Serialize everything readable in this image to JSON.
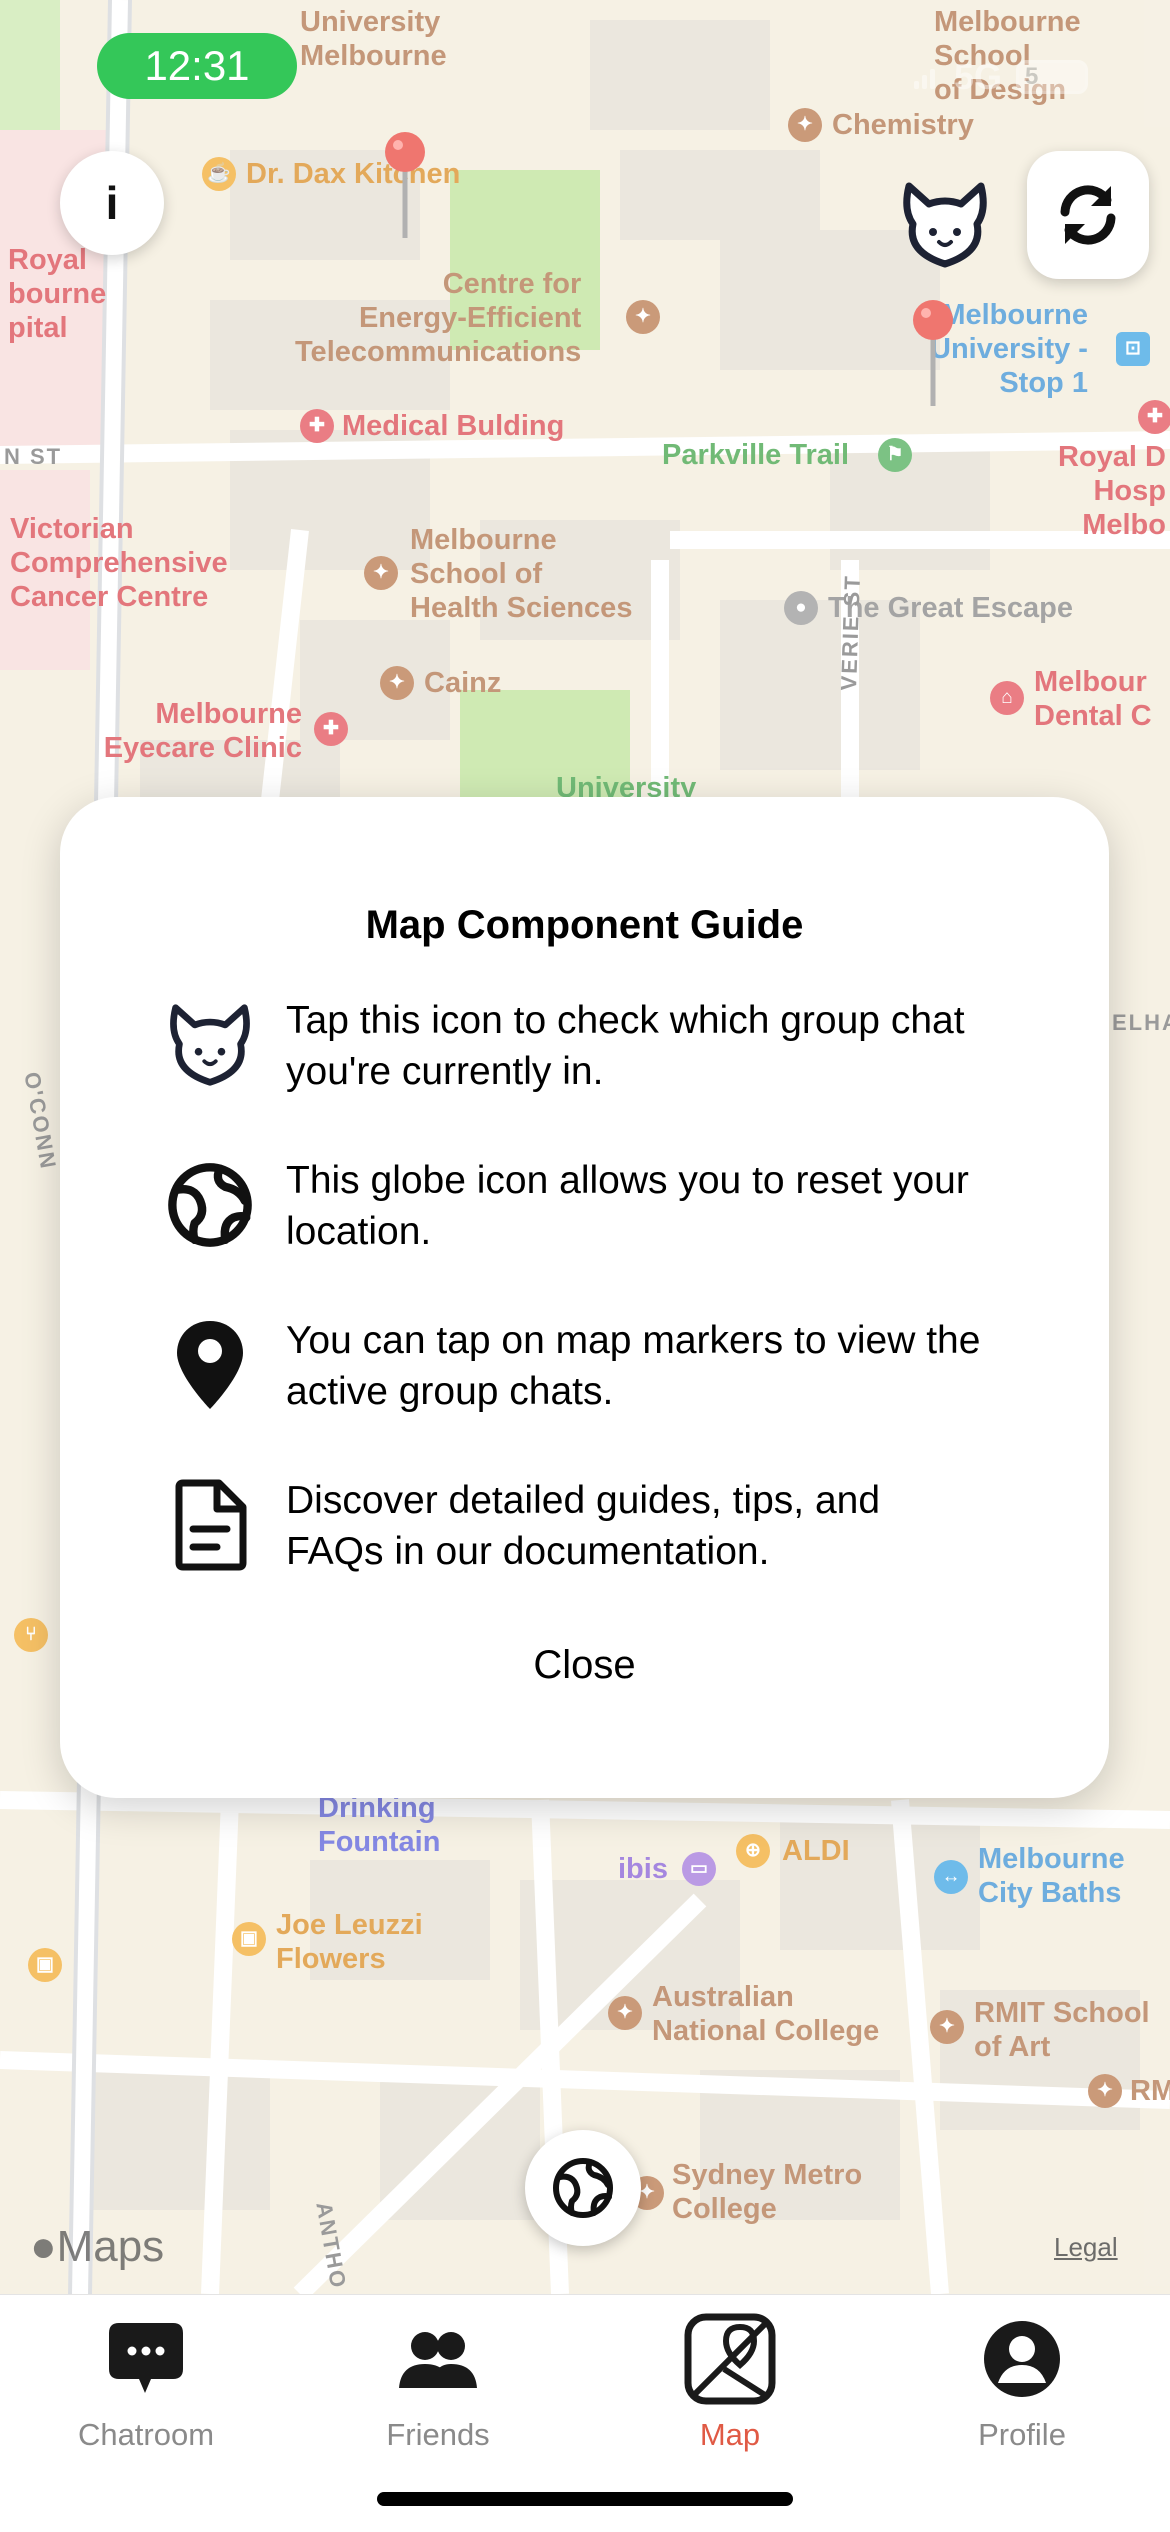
{
  "status_bar": {
    "time": "12:31",
    "network": "5G",
    "battery": "5"
  },
  "map": {
    "pois": [
      {
        "name": "University\nMelbourne",
        "color": "brown"
      },
      {
        "name": "Melbourne School\nof Design",
        "color": "brown"
      },
      {
        "name": "Chemistry",
        "color": "brown"
      },
      {
        "name": "Dr. Dax Kitchen",
        "color": "orange"
      },
      {
        "name": "Centre for\nEnergy-Efficient\nTelecommunications",
        "color": "brown"
      },
      {
        "name": "Medical Bulding",
        "color": "red"
      },
      {
        "name": "Melbourne\nUniversity -\nStop 1",
        "color": "blue"
      },
      {
        "name": "Parkville Trail",
        "color": "green"
      },
      {
        "name": "Royal D\nHosp\nMelbo",
        "color": "red"
      },
      {
        "name": "Royal\nbourne\npital",
        "color": "red"
      },
      {
        "name": "Victorian\nComprehensive\nCancer Centre",
        "color": "red"
      },
      {
        "name": "Melbourne\nSchool of\nHealth Sciences",
        "color": "brown"
      },
      {
        "name": "The Great Escape",
        "color": "gray"
      },
      {
        "name": "Cainz",
        "color": "brown"
      },
      {
        "name": "Melbourne\nEyecare Clinic",
        "color": "red"
      },
      {
        "name": "Melbour\nDental C",
        "color": "red"
      },
      {
        "name": "University",
        "color": "green"
      },
      {
        "name": "Drinking\nFountain",
        "color": "indigo"
      },
      {
        "name": "ibis",
        "color": "purple"
      },
      {
        "name": "ALDI",
        "color": "orange"
      },
      {
        "name": "Melbourne\nCity Baths",
        "color": "blue"
      },
      {
        "name": "Joe Leuzzi\nFlowers",
        "color": "orange"
      },
      {
        "name": "Australian\nNational College",
        "color": "brown"
      },
      {
        "name": "RMIT School\nof Art",
        "color": "brown"
      },
      {
        "name": "Sydney Metro\nCollege",
        "color": "brown"
      },
      {
        "name": "RM",
        "color": "brown"
      }
    ],
    "streets": [
      "N ST",
      "VERIE ST",
      "O'CONN",
      "ANTHO",
      "ELHA"
    ],
    "maps_logo": "Maps",
    "legal": "Legal"
  },
  "controls": {
    "info_label": "i"
  },
  "modal": {
    "title": "Map Component Guide",
    "items": [
      {
        "icon": "bunny-icon",
        "text": "Tap this icon to check which group chat you're currently in."
      },
      {
        "icon": "globe-icon",
        "text": "This globe icon allows you to reset your location."
      },
      {
        "icon": "map-pin-icon",
        "text": "You can tap on map markers to view the active group chats."
      },
      {
        "icon": "document-icon",
        "text": "Discover detailed guides, tips, and FAQs in our documentation."
      }
    ],
    "close_label": "Close"
  },
  "tabs": [
    {
      "label": "Chatroom",
      "icon": "chat-bubble-icon",
      "active": false
    },
    {
      "label": "Friends",
      "icon": "people-icon",
      "active": false
    },
    {
      "label": "Map",
      "icon": "map-icon",
      "active": true
    },
    {
      "label": "Profile",
      "icon": "person-icon",
      "active": false
    }
  ],
  "colors": {
    "accent": "#e05a45",
    "time_pill": "#34c759",
    "pin": "#e8362c"
  }
}
